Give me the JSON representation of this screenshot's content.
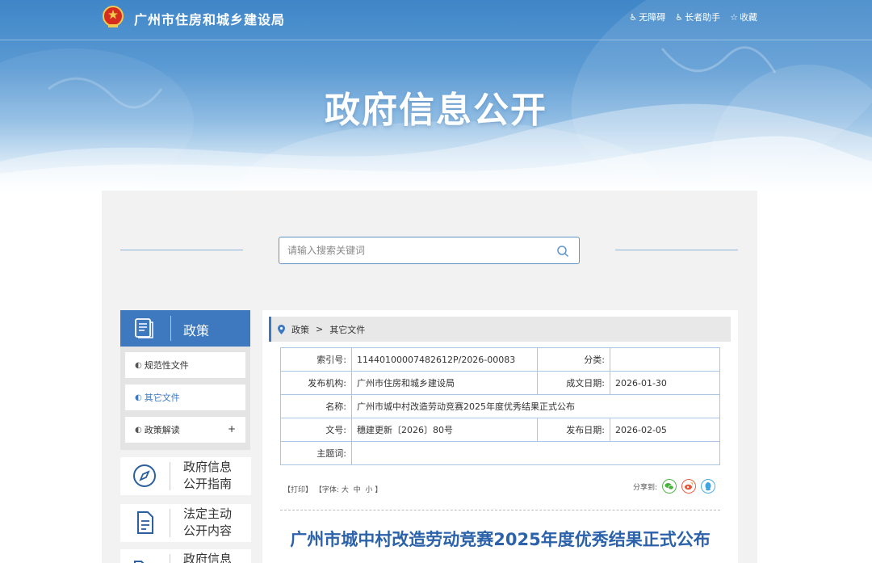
{
  "header": {
    "site_name": "广州市住房和城乡建设局",
    "links": [
      {
        "icon": "wheelchair-icon",
        "label": "无障碍"
      },
      {
        "icon": "elder-assist-icon",
        "label": "长者助手"
      },
      {
        "icon": "star-icon",
        "label": "收藏"
      }
    ],
    "banner_title": "政府信息公开"
  },
  "search": {
    "placeholder": "请输入搜索关键词"
  },
  "sidebar": {
    "title": "政策",
    "items": [
      {
        "label": "规范性文件",
        "active": false
      },
      {
        "label": "其它文件",
        "active": true
      },
      {
        "label": "政策解读",
        "active": false,
        "expand": "+"
      }
    ],
    "cards": [
      {
        "icon": "compass-icon",
        "line1": "政府信息",
        "line2": "公开指南"
      },
      {
        "icon": "document-icon",
        "line1": "法定主动",
        "line2": "公开内容"
      },
      {
        "icon": "folder-icon",
        "line1": "政府信息",
        "line2": ""
      }
    ]
  },
  "breadcrumb": {
    "items": [
      "政策",
      "其它文件"
    ],
    "separator": ">"
  },
  "meta": {
    "index_label": "索引号:",
    "index_value": "11440100007482612P/2026-00083",
    "category_label": "分类:",
    "category_value": "",
    "publisher_label": "发布机构:",
    "publisher_value": "广州市住房和城乡建设局",
    "created_label": "成文日期:",
    "created_value": "2026-01-30",
    "name_label": "名称:",
    "name_value": "广州市城中村改造劳动竞赛2025年度优秀结果正式公布",
    "docno_label": "文号:",
    "docno_value": "穗建更新〔2026〕80号",
    "published_label": "发布日期:",
    "published_value": "2026-02-05",
    "keywords_label": "主题词:",
    "keywords_value": ""
  },
  "tools": {
    "print": "【打印】",
    "font_prefix": "【字体:",
    "large": "大",
    "medium": "中",
    "small": "小",
    "font_suffix": "】"
  },
  "share": {
    "label": "分享到:",
    "targets": [
      "wechat-icon",
      "weibo-icon",
      "qq-icon"
    ]
  },
  "article": {
    "title": "广州市城中村改造劳动竞赛2025年度优秀结果正式公布"
  },
  "colors": {
    "primary": "#3e79c0",
    "title_blue": "#2b62a9",
    "table_border": "#a9c7e5",
    "content_bg": "#f2f2f2"
  }
}
